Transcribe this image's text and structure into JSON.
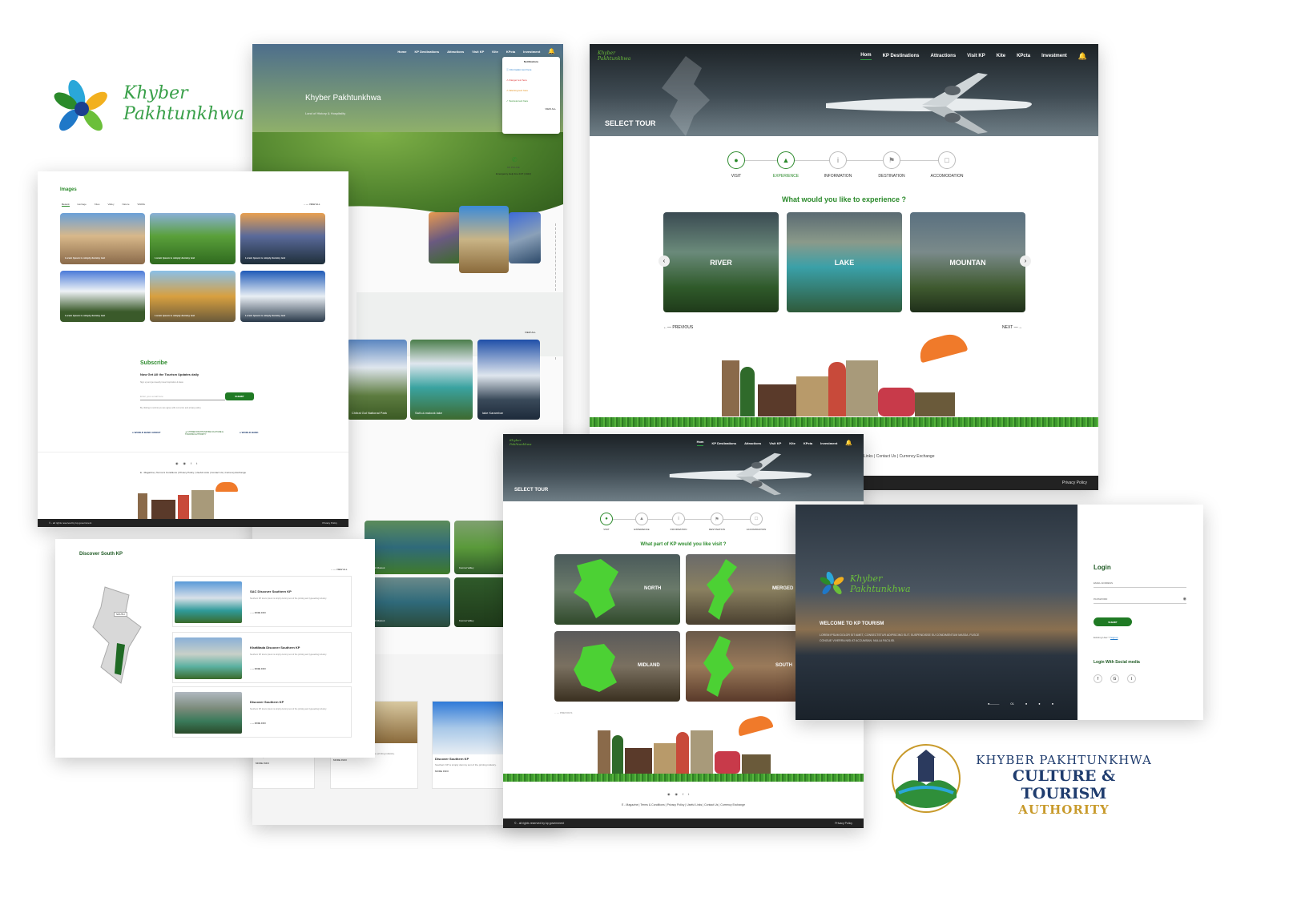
{
  "colors": {
    "brand_green": "#2b8a2b",
    "dark": "#222222",
    "gold": "#c89a2b",
    "navy": "#1f3c6e"
  },
  "brand": {
    "logo_line1": "Khyber",
    "logo_line2": "Pakhtunkhwa"
  },
  "authority": {
    "line1": "KHYBER PAKHTUNKHWA",
    "line2": "CULTURE & TOURISM",
    "line3": "AUTHORITY"
  },
  "home": {
    "nav": [
      "Home",
      "KP Destinations",
      "Attractions",
      "Visit KP",
      "Kite",
      "KPcta",
      "Investment"
    ],
    "hero_title": "Khyber Pakhtunkhwa",
    "hero_subtitle": "Land of History & Hospitality",
    "notifications_title": "Notifications",
    "notifications": [
      "Information text here",
      "Danger text here",
      "Warning text here",
      "Success text here"
    ],
    "notif_view_all": "VIEW ALL",
    "helpline_label": "Emergency Help line 24/7",
    "helpline_number": "(1422)",
    "helpline_icon_text": "KP POLICE",
    "gallery_cards": [
      "Chitral Gol National Park",
      "Saif-ul-malook lake",
      "lake Karambar"
    ],
    "view_all": "VIEW ALL",
    "discover_cards": [
      {
        "title": "Discover Southern KP",
        "text": "Southern KP is simply dummy text of the printing industry."
      },
      {
        "title": "Discover Southern KP",
        "text": "Southern KP is simply dummy text of the printing industry."
      },
      {
        "title": "Discover Southern KP",
        "text": "Southern KP is simply dummy text of the printing industry."
      }
    ],
    "more_info": "MORE INFO",
    "thumbs": [
      "Saif Ul Malook",
      "Kumrat Valley",
      "Saif Ul Malook",
      "Kumrat Valley"
    ]
  },
  "images_page": {
    "title": "Images",
    "tabs": [
      "Recent",
      "Heritage",
      "Kites",
      "Valley",
      "Nature",
      "Wildlife"
    ],
    "view_all": "VIEW ALL",
    "caption": "Lorem Ipsum is simply dummy text",
    "subscribe_title": "Subscribe",
    "subscribe_heading": "Now Get All the Tourism Updates daily",
    "subscribe_sub": "Sign up and get weekly travel inspiration & ideas",
    "email_placeholder": "Enter your email here",
    "submit": "SUBMIT",
    "consent": "By clicking to submit you are agree with our terms and privacy policy",
    "partners": [
      "WORLD BANK GROUP",
      "KHYBER PAKHTUNKHWA CULTURE & TOURISM AUTHORITY",
      "WORLD BANK"
    ],
    "footer_links": "E - Magazine | Terms & Conditions | Privacy Policy | Useful Links | Contact Us | Currency Exchange",
    "copyright": "© - all rights reserved by kp government",
    "privacy": "Privacy Policy"
  },
  "discover_page": {
    "title": "Discover South KP",
    "view_all": "VIEW ALL",
    "map_label": "SOUTH",
    "items": [
      {
        "title": "SAC Discover Southern KP",
        "text": "Southern KP lorem Ipsum is simply dummy text of the printing and typesetting industry."
      },
      {
        "title": "KhaMtada Discover Southern KP",
        "text": "Southern KP lorem Ipsum is simply dummy text of the printing and typesetting industry."
      },
      {
        "title": "Discover Southern KP",
        "text": "Southern KP lorem Ipsum is simply dummy text of the printing and typesetting industry."
      }
    ],
    "more_info": "MORE INFO"
  },
  "tour_page": {
    "nav": [
      "Hom",
      "KP Destinations",
      "Attractions",
      "Visit KP",
      "Kite",
      "KPcta",
      "Investment"
    ],
    "hero_label": "SELECT TOUR",
    "steps": [
      "VISIT",
      "EXPERIENCE",
      "INFORMATION",
      "DESTINATION",
      "ACCOMODATION"
    ],
    "question": "What would you like to experience ?",
    "options": [
      "RIVER",
      "LAKE",
      "MOUNTAN"
    ],
    "previous": "PREVIOUS",
    "next": "NEXT",
    "footer_links": "Links | Contact Us | Currency Exchange",
    "privacy": "Privacy Policy"
  },
  "region_page": {
    "nav": [
      "Hom",
      "KP Destinations",
      "Attractions",
      "Visit KP",
      "Kite",
      "KPcta",
      "Investment"
    ],
    "hero_label": "SELECT TOUR",
    "steps": [
      "VISIT",
      "EXPERIENCE",
      "INFORMATION",
      "DESTINATION",
      "ACCOMODATION"
    ],
    "question": "What part of KP would you like visit ?",
    "regions": [
      "NORTH",
      "MERGED",
      "MIDLAND",
      "SOUTH"
    ],
    "previous": "PREVIOUS",
    "footer_links": "E - Magazine | Terms & Conditions | Privacy Policy | Useful Links | Contact Us | Currency Exchange",
    "copyright": "© - all rights reserved by kp government",
    "privacy": "Privacy Policy"
  },
  "login_page": {
    "welcome": "WELCOME TO KP TOURISM",
    "body": "LOREM IPSUM DOLOR SIT AMET, CONSECTETUR ADIPISCING ELIT. SUSPENDISSE EU CONDIMENTUM MASSA. FUSCE CONGUE VIVERRA NISI AT ACCUMSAN. NULLA FACILISI.",
    "login_title": "Login",
    "email_label": "EMAIL ADDRESS",
    "password_label": "PASSWORD",
    "submit": "SUBMIT",
    "existing": "Existing User ?",
    "signup": "Signup",
    "social_title": "Login With  Social media",
    "slide_num": "01"
  }
}
